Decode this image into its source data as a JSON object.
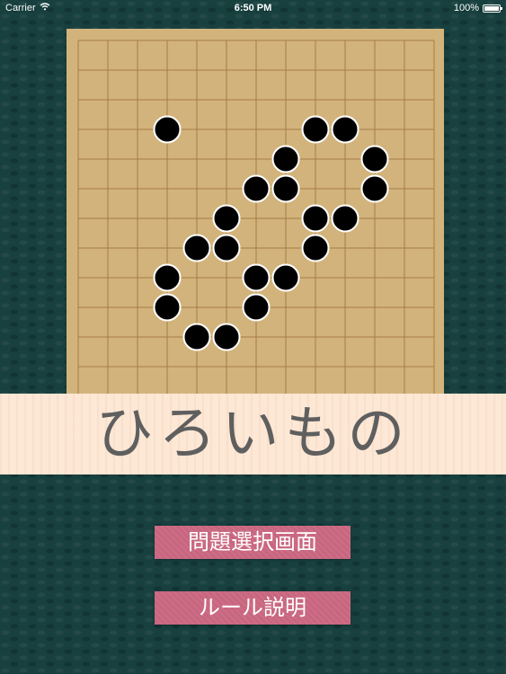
{
  "status_bar": {
    "carrier": "Carrier",
    "time": "6:50 PM",
    "battery": "100%",
    "battery_level": 1.0
  },
  "board": {
    "size": 13,
    "line_color": "#a57d45",
    "board_color": "#d2b37b",
    "stones": [
      {
        "col": 3,
        "row": 3
      },
      {
        "col": 8,
        "row": 3
      },
      {
        "col": 9,
        "row": 3
      },
      {
        "col": 7,
        "row": 4
      },
      {
        "col": 10,
        "row": 4
      },
      {
        "col": 6,
        "row": 5
      },
      {
        "col": 7,
        "row": 5
      },
      {
        "col": 10,
        "row": 5
      },
      {
        "col": 5,
        "row": 6
      },
      {
        "col": 8,
        "row": 6
      },
      {
        "col": 9,
        "row": 6
      },
      {
        "col": 4,
        "row": 7
      },
      {
        "col": 5,
        "row": 7
      },
      {
        "col": 8,
        "row": 7
      },
      {
        "col": 3,
        "row": 8
      },
      {
        "col": 6,
        "row": 8
      },
      {
        "col": 7,
        "row": 8
      },
      {
        "col": 3,
        "row": 9
      },
      {
        "col": 6,
        "row": 9
      },
      {
        "col": 4,
        "row": 10
      },
      {
        "col": 5,
        "row": 10
      }
    ]
  },
  "title": "ひろいもの",
  "menu": {
    "problem_select": "問題選択画面",
    "rules": "ルール説明"
  },
  "colors": {
    "background": "#17403f",
    "title_band": "#fde7d5",
    "title_text": "#5f5f5f",
    "button": "#c9667f",
    "stone": "#000000"
  }
}
